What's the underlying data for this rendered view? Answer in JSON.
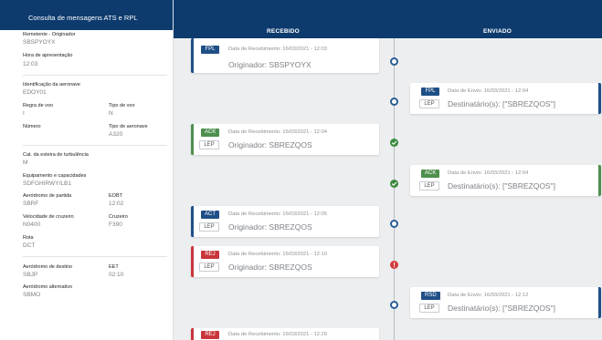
{
  "app": {
    "title": "Consulta de mensagens ATS e RPL"
  },
  "left": {
    "remetente_label": "Remetente - Originador",
    "remetente_value": "SBSPYOYX",
    "hora_label": "Hora de apresentação",
    "hora_value": "12:03",
    "ident_label": "Identificação da aeronave",
    "ident_value": "EDOY01",
    "regra_label": "Regra de voo",
    "regra_value": "I",
    "tipo_voo_label": "Tipo de voo",
    "tipo_voo_value": "N",
    "numero_label": "Número",
    "tipo_aero_label": "Tipo de aeronave",
    "tipo_aero_value": "A320",
    "esteira_label": "Cat. da esteira de turbulência",
    "esteira_value": "M",
    "equip_label": "Equipamento e capacidades",
    "equip_value": "SDFGHIRWY/LB1",
    "partida_label": "Aeródromo de partida",
    "partida_value": "SBRF",
    "eobt_label": "EOBT",
    "eobt_value": "12:02",
    "velocidade_label": "Velocidade de cruzeiro",
    "velocidade_value": "N0400",
    "cruzeiro_label": "Cruzeiro",
    "cruzeiro_value": "F390",
    "rota_label": "Rota",
    "rota_value": "DCT",
    "destino_label": "Aeródromo de destino",
    "destino_value": "SBJP",
    "eet_label": "EET",
    "eet_value": "02:10",
    "alternativo_label": "Aeródromo alternativo",
    "alternativo_value": "SBMO"
  },
  "columns": {
    "recebido": "RECEBIDO",
    "enviado": "ENVIADO"
  },
  "colors": {
    "header": "#0e3b6e",
    "fpl": "#1f4f86",
    "ack": "#4e8f4e",
    "act": "#1f4f86",
    "rej": "#c9353c",
    "rsd": "#1f4f86"
  },
  "timeline": {
    "received": [
      {
        "type": "FPL",
        "date": "Data de Recebimento: 16/03/2021 - 12:03",
        "main": "Originador: SBSPYOYX",
        "lep": ""
      },
      {
        "type": "ACK",
        "date": "Data de Recebimento: 16/03/2021 - 12:04",
        "main": "Originador: SBREZQOS",
        "lep": "LEP"
      },
      {
        "type": "ACT",
        "date": "Data de Recebimento: 16/03/2021 - 12:05",
        "main": "Originador: SBREZQOS",
        "lep": "LEP"
      },
      {
        "type": "REJ",
        "date": "Data de Recebimento: 16/03/2021 - 12:10",
        "main": "Originador: SBREZQOS",
        "lep": "LEP"
      },
      {
        "type": "REJ",
        "date": "Data de Recebimento: 16/03/2021 - 12:29",
        "main": "",
        "lep": ""
      }
    ],
    "sent": [
      {
        "type": "FPL",
        "date": "Data de Envio: 16/03/2021 - 12:04",
        "main": "Destinatário(s): [\"SBREZQOS\"]",
        "lep": "LEP"
      },
      {
        "type": "ACK",
        "date": "Data de Envio: 16/03/2021 - 12:04",
        "main": "Destinatário(s): [\"SBREZQOS\"]",
        "lep": "LEP"
      },
      {
        "type": "RSD",
        "date": "Data de Envio: 16/03/2021 - 12:12",
        "main": "Destinatário(s): [\"SBREZQOS\"]",
        "lep": "LEP"
      }
    ]
  }
}
